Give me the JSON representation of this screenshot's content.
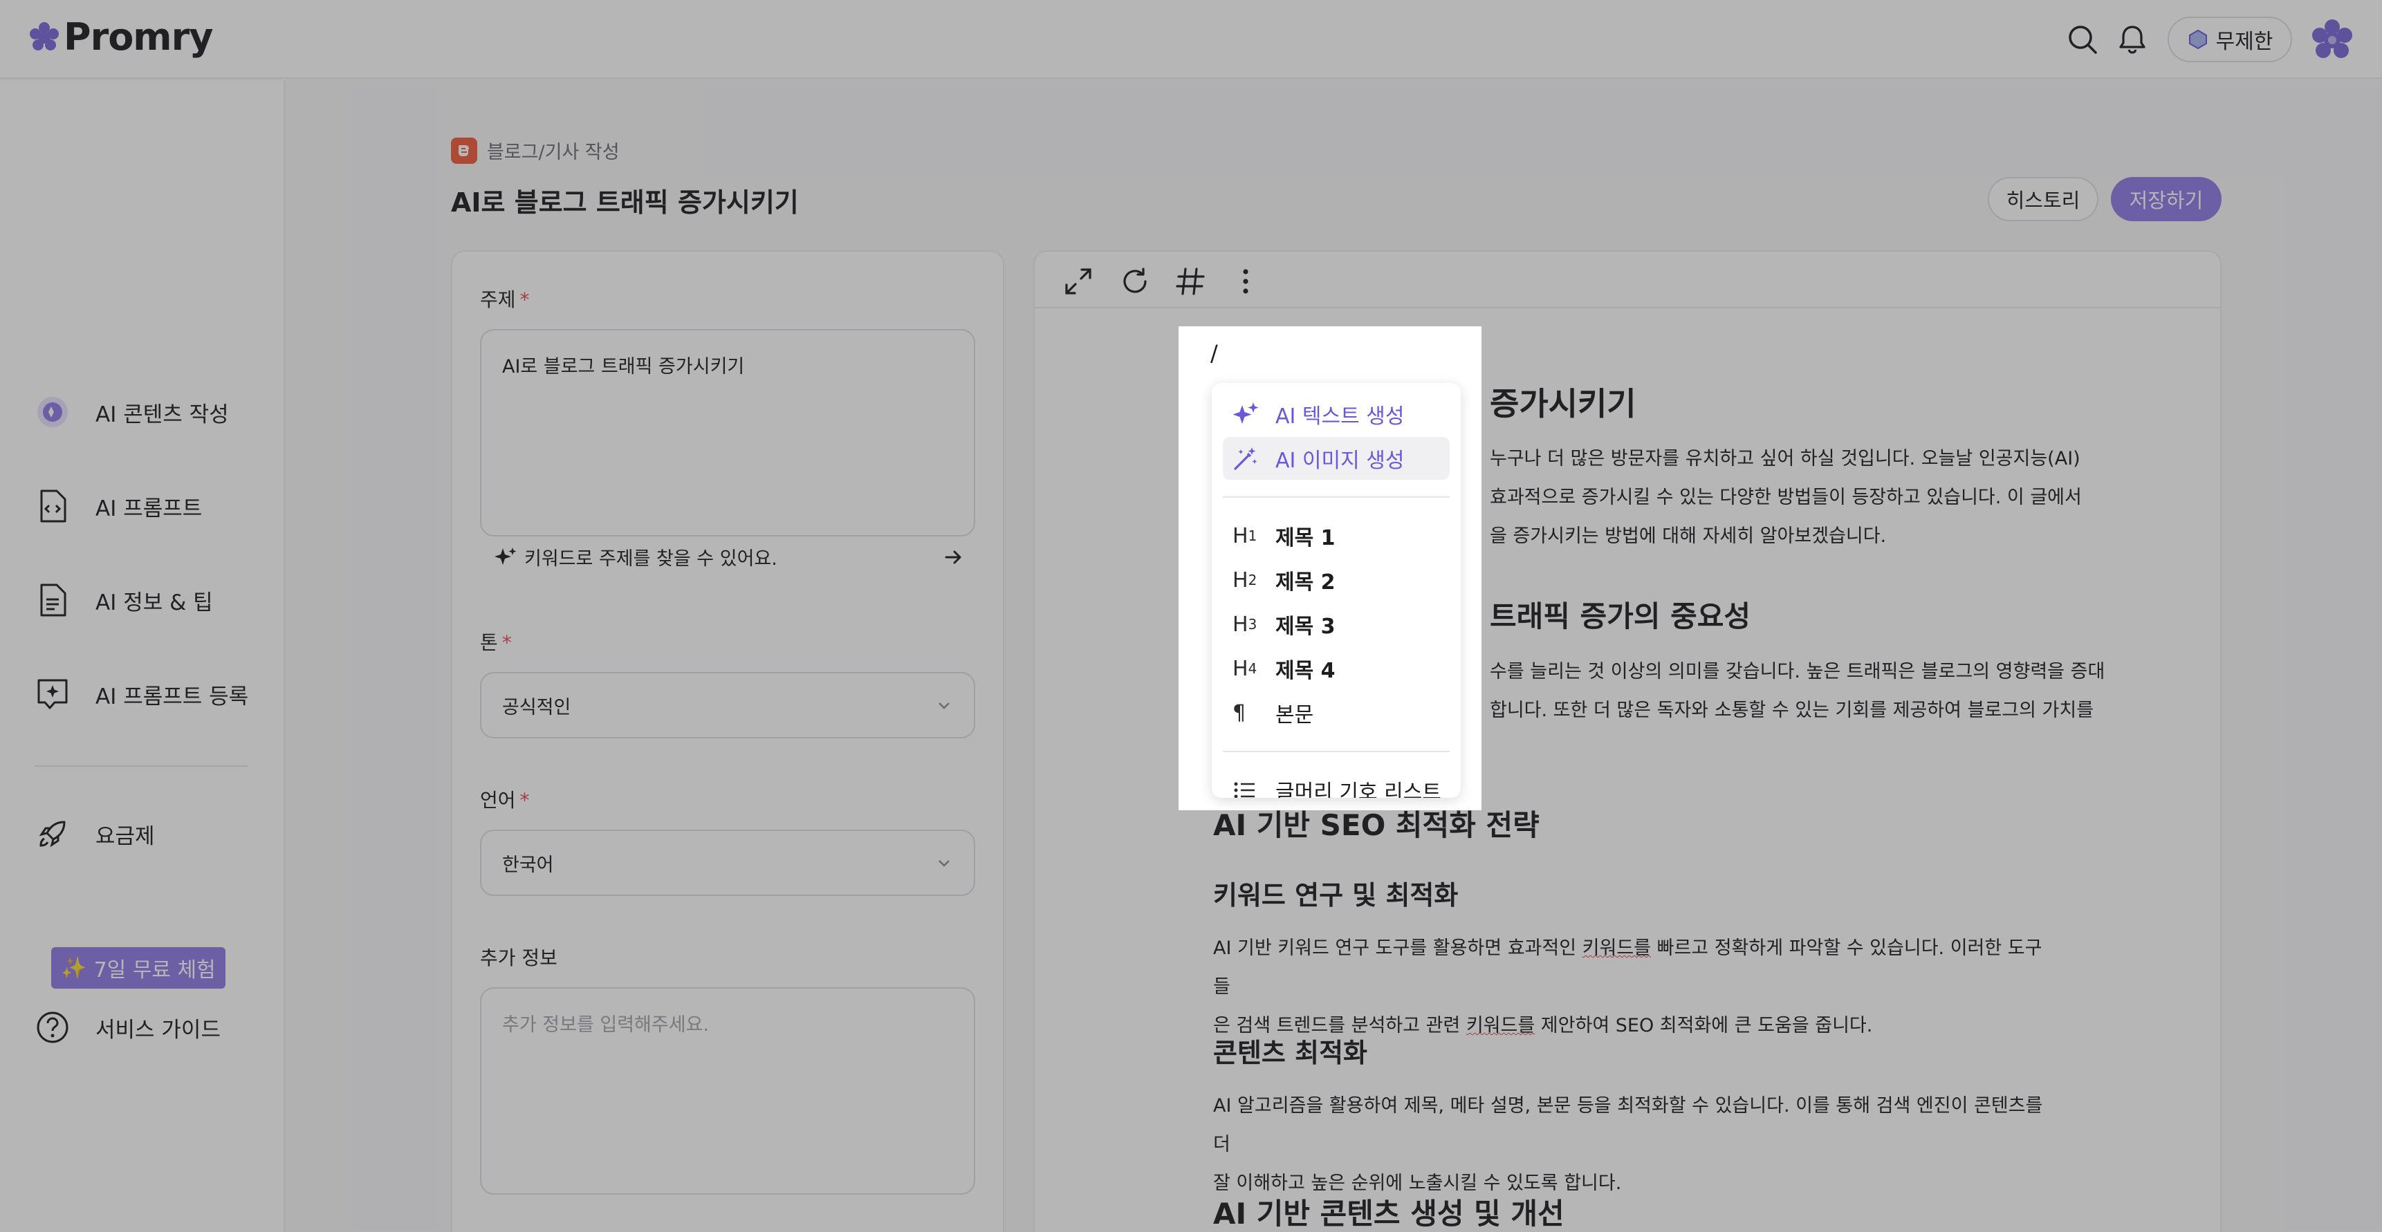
{
  "app": {
    "name": "Promry"
  },
  "header": {
    "plan_label": "무제한"
  },
  "sidebar": {
    "items": [
      {
        "label": "AI 콘텐츠 작성"
      },
      {
        "label": "AI 프롬프트"
      },
      {
        "label": "AI 정보 & 팁"
      },
      {
        "label": "AI 프롬프트 등록"
      },
      {
        "label": "요금제"
      },
      {
        "label": "서비스 가이드"
      }
    ],
    "trial_badge": "7일 무료 체험"
  },
  "page": {
    "breadcrumb": "블로그/기사 작성",
    "title": "AI로 블로그 트래픽 증가시키기",
    "history_label": "히스토리",
    "save_label": "저장하기"
  },
  "form": {
    "topic": {
      "label": "주제",
      "required_mark": "*",
      "value": "AI로 블로그 트래픽 증가시키기",
      "hint": "키워드로 주제를 찾을 수 있어요."
    },
    "tone": {
      "label": "톤",
      "required_mark": "*",
      "value": "공식적인"
    },
    "language": {
      "label": "언어",
      "required_mark": "*",
      "value": "한국어"
    },
    "extra": {
      "label": "추가 정보",
      "placeholder": "추가 정보를 입력해주세요."
    }
  },
  "editor": {
    "doc": {
      "h1_tail": "증가시키기",
      "p1_line1": "누구나 더 많은 방문자를 유치하고 싶어 하실 것입니다. 오늘날 인공지능(AI)",
      "p1_line2": "효과적으로 증가시킬 수 있는 다양한 방법들이 등장하고 있습니다. 이 글에서",
      "p1_line3": "을 증가시키는 방법에 대해 자세히 알아보겠습니다.",
      "h2a_tail": "트래픽 증가의 중요성",
      "p2_line1": "수를 늘리는 것 이상의 의미를 갖습니다. 높은 트래픽은 블로그의 영향력을 증대",
      "p2_line2": "합니다. 또한 더 많은 독자와 소통할 수 있는 기회를 제공하여 블로그의 가치를",
      "h2b": "AI 기반 SEO 최적화 전략",
      "h3a": "키워드 연구 및 최적화",
      "p3_pre": "AI 기반 키워드 연구 도구를 활용하면 효과적인 ",
      "p3_mark": "키워드를",
      "p3_post": " 빠르고 정확하게 파악할 수 있습니다. 이러한 도구들",
      "p3b_pre": "은 검색 트렌드를 분석하고 관련 ",
      "p3b_mark": "키워드를",
      "p3b_post": " 제안하여 SEO 최적화에 큰 도움을 줍니다.",
      "h3b": "콘텐츠 최적화",
      "p4_line1": "AI 알고리즘을 활용하여 제목, 메타 설명, 본문 등을 최적화할 수 있습니다. 이를 통해 검색 엔진이 콘텐츠를 더",
      "p4_line2": "잘 이해하고 높은 순위에 노출시킬 수 있도록 합니다.",
      "h2c": "AI 기반 콘텐츠 생성 및 개선"
    }
  },
  "slash_menu": {
    "trigger": "/",
    "items": [
      {
        "label": "AI 텍스트 생성"
      },
      {
        "label": "AI 이미지 생성"
      },
      {
        "prefix": "H",
        "num": "1",
        "label": "제목 1"
      },
      {
        "prefix": "H",
        "num": "2",
        "label": "제목 2"
      },
      {
        "prefix": "H",
        "num": "3",
        "label": "제목 3"
      },
      {
        "prefix": "H",
        "num": "4",
        "label": "제목 4"
      },
      {
        "prefix": "¶",
        "label": "본문"
      },
      {
        "label": "글머리 기호 리스트"
      }
    ]
  },
  "colors": {
    "accent": "#8f7be6",
    "ai_text": "#6b57d8",
    "required": "#e5484d",
    "blog_icon": "#f25c3c"
  }
}
